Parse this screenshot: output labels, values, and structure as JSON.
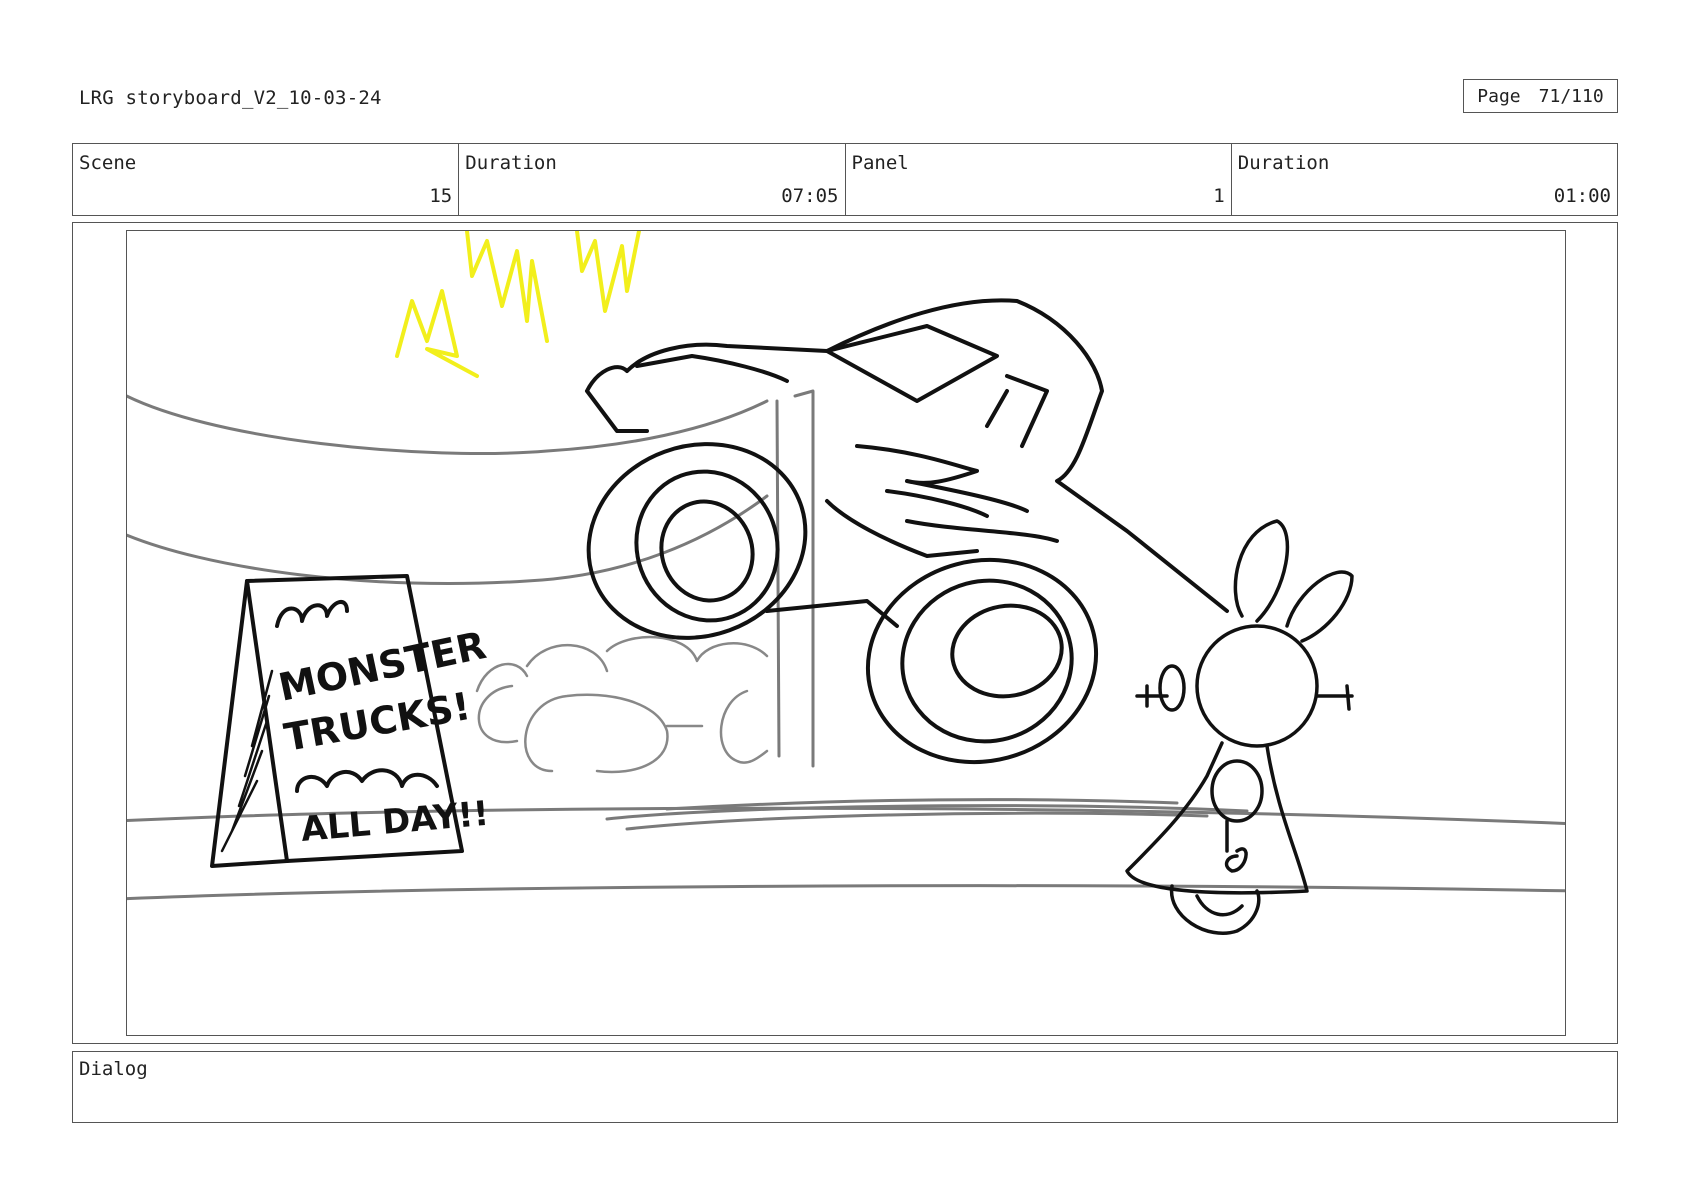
{
  "header": {
    "document_title": "LRG storyboard_V2_10-03-24",
    "page_label": "Page",
    "page_number": "71/110"
  },
  "info": {
    "scene_label": "Scene",
    "scene_value": "15",
    "scene_duration_label": "Duration",
    "scene_duration_value": "07:05",
    "panel_label": "Panel",
    "panel_value": "1",
    "panel_duration_label": "Duration",
    "panel_duration_value": "01:00"
  },
  "panel_sign": {
    "line1": "MONSTER",
    "line2": "TRUCKS!",
    "line3": "ALL DAY!!"
  },
  "dialog": {
    "label": "Dialog",
    "text": ""
  },
  "colors": {
    "ink": "#111111",
    "pencil_gray": "#7a7a7a",
    "highlight_yellow": "#f2ef1c"
  }
}
